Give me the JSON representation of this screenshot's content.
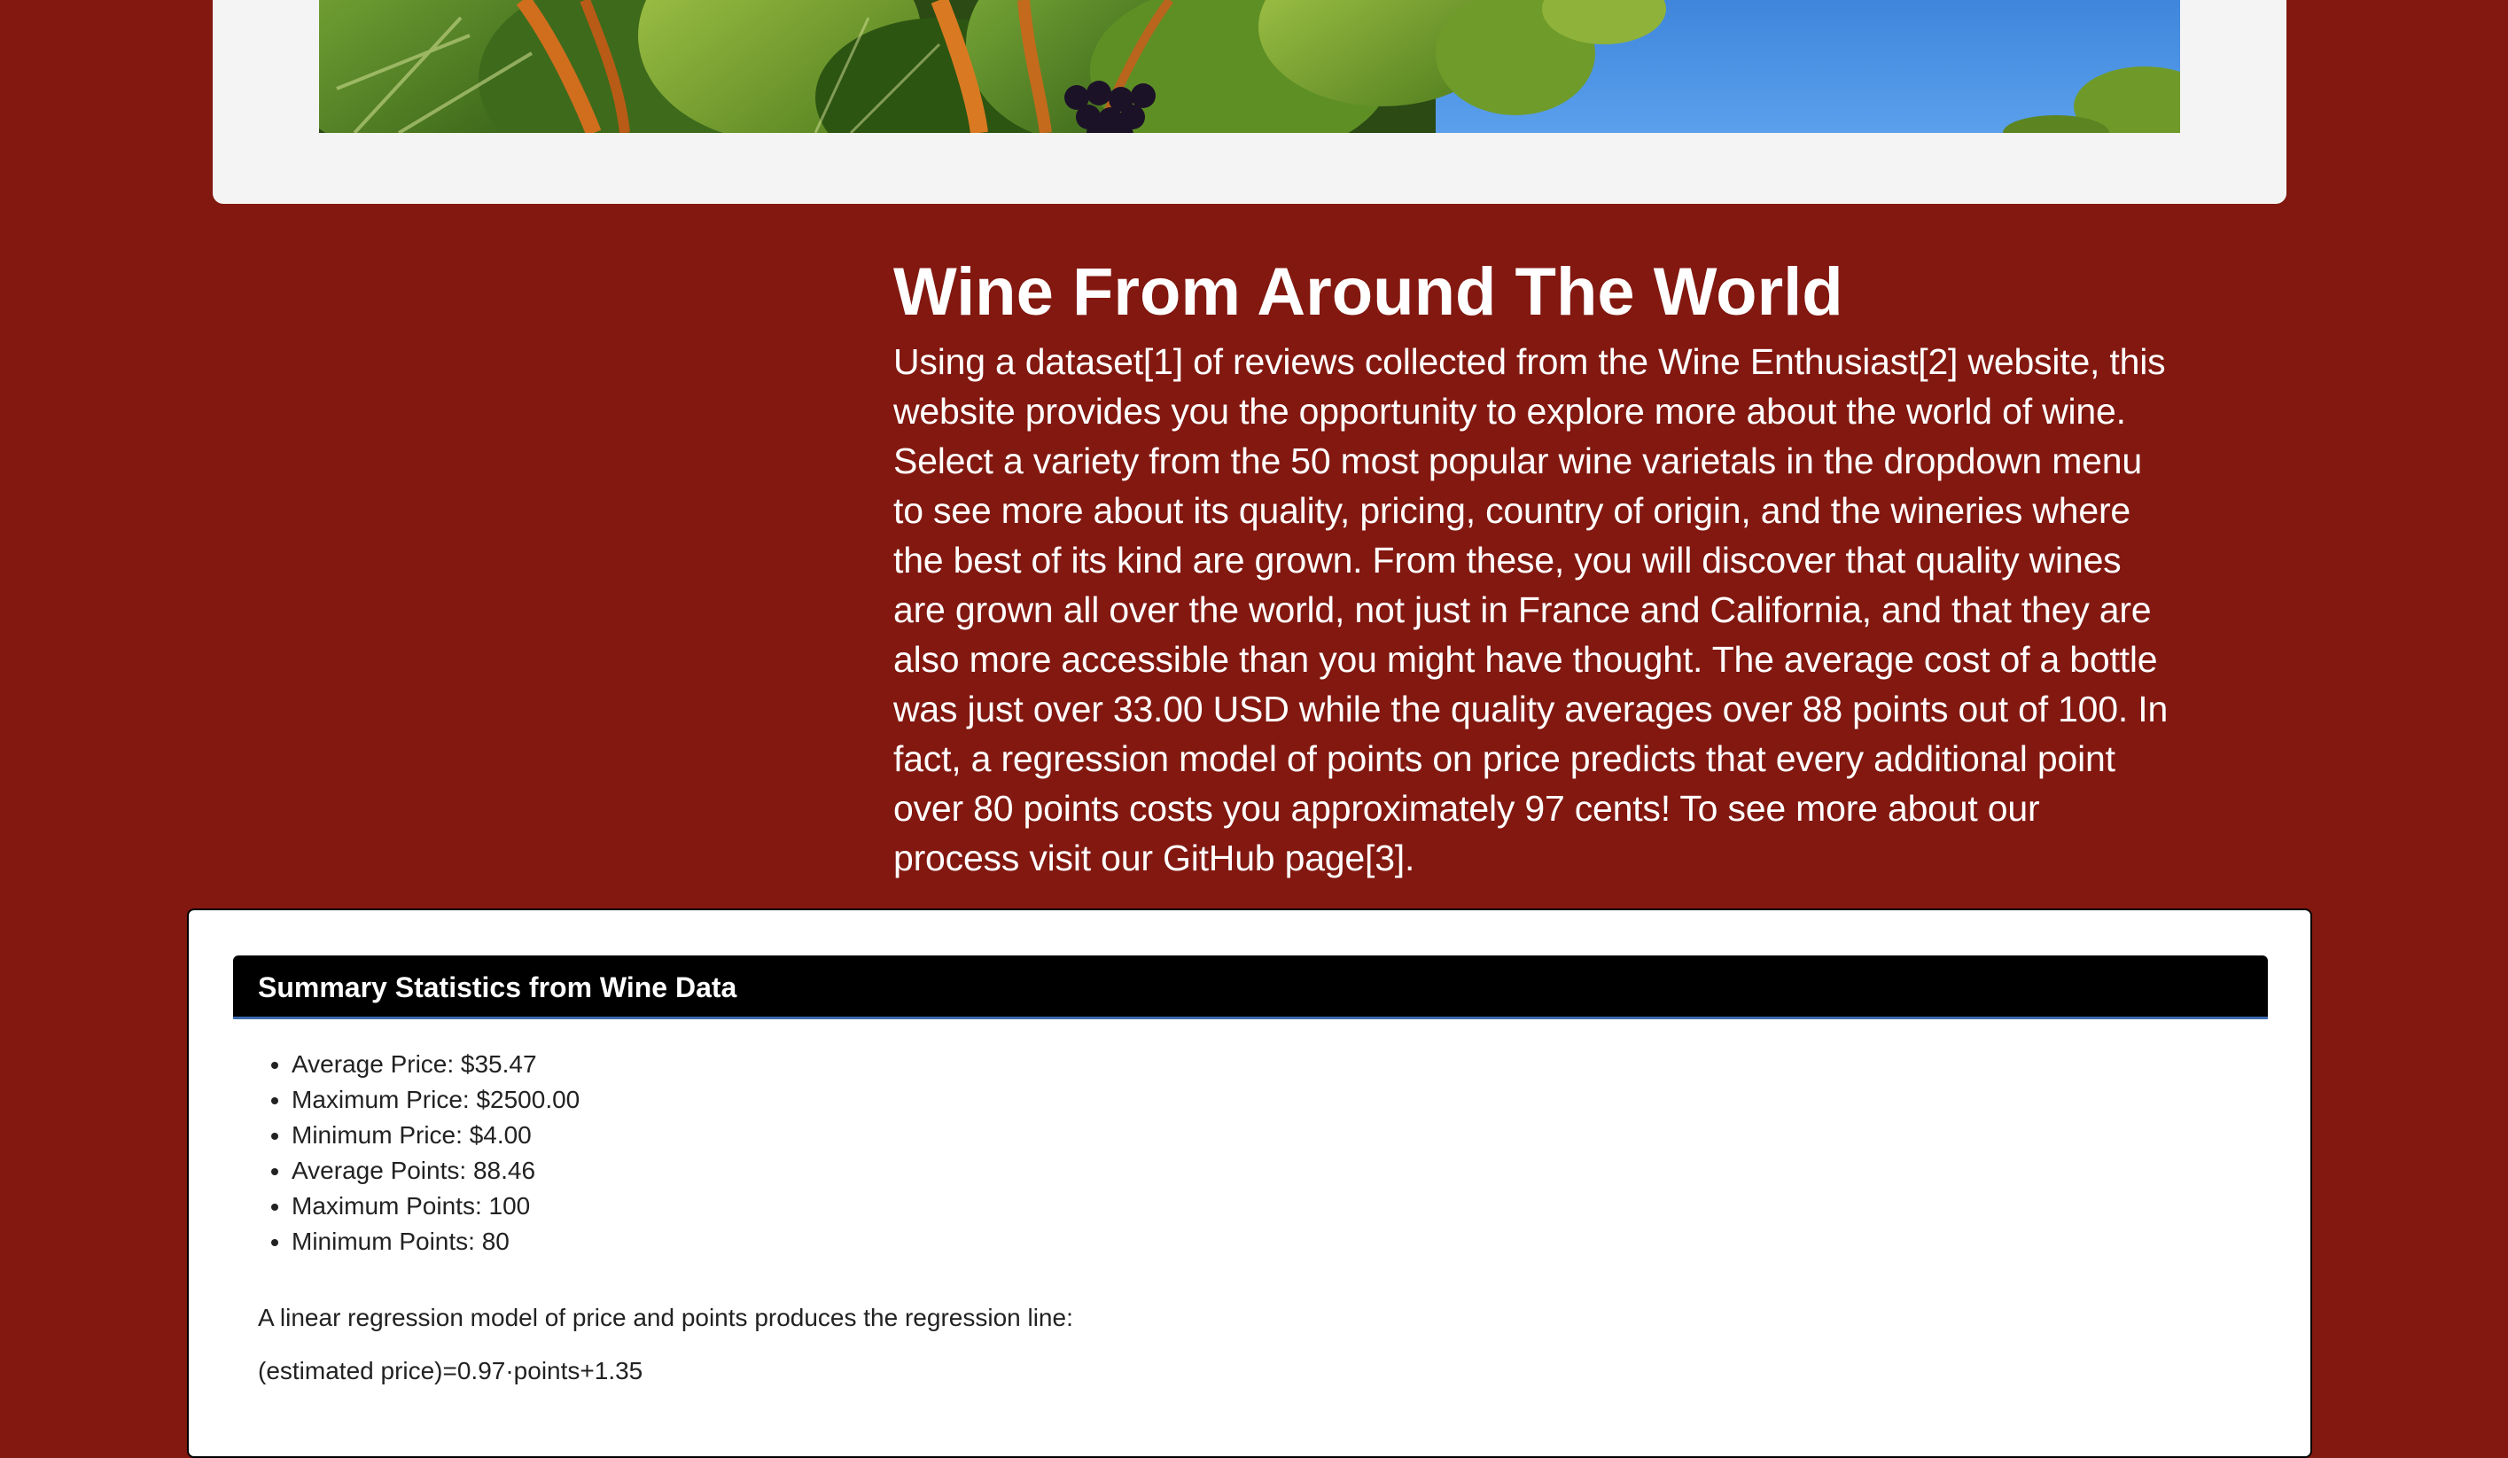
{
  "intro": {
    "title": "Wine From Around The World",
    "paragraph": "Using a dataset[1] of reviews collected from the Wine Enthusiast[2] website, this website provides you the opportunity to explore more about the world of wine. Select a variety from the 50 most popular wine varietals in the dropdown menu to see more about its quality, pricing, country of origin, and the wineries where the best of its kind are grown. From these, you will discover that quality wines are grown all over the world, not just in France and California, and that they are also more accessible than you might have thought. The average cost of a bottle was just over 33.00 USD while the quality averages over 88 points out of 100. In fact, a regression model of points on price predicts that every additional point over 80 points costs you approximately 97 cents! To see more about our process visit our GitHub page[3]."
  },
  "summary": {
    "header": "Summary Statistics from Wine Data",
    "stats": [
      "Average Price: $35.47",
      "Maximum Price: $2500.00",
      "Minimum Price: $4.00",
      "Average Points: 88.46",
      "Maximum Points: 100",
      "Minimum Points: 80"
    ],
    "regression_text": "A linear regression model of price and points produces the regression line:",
    "regression_equation": "(estimated price)=0.97·points+1.35"
  },
  "colors": {
    "page_background": "#821810",
    "jumbotron_background": "#f4f4f4",
    "card_header_background": "#000000",
    "card_header_border": "#3c6bb0"
  },
  "icons": {
    "hero": "vineyard-grapes-photo"
  }
}
